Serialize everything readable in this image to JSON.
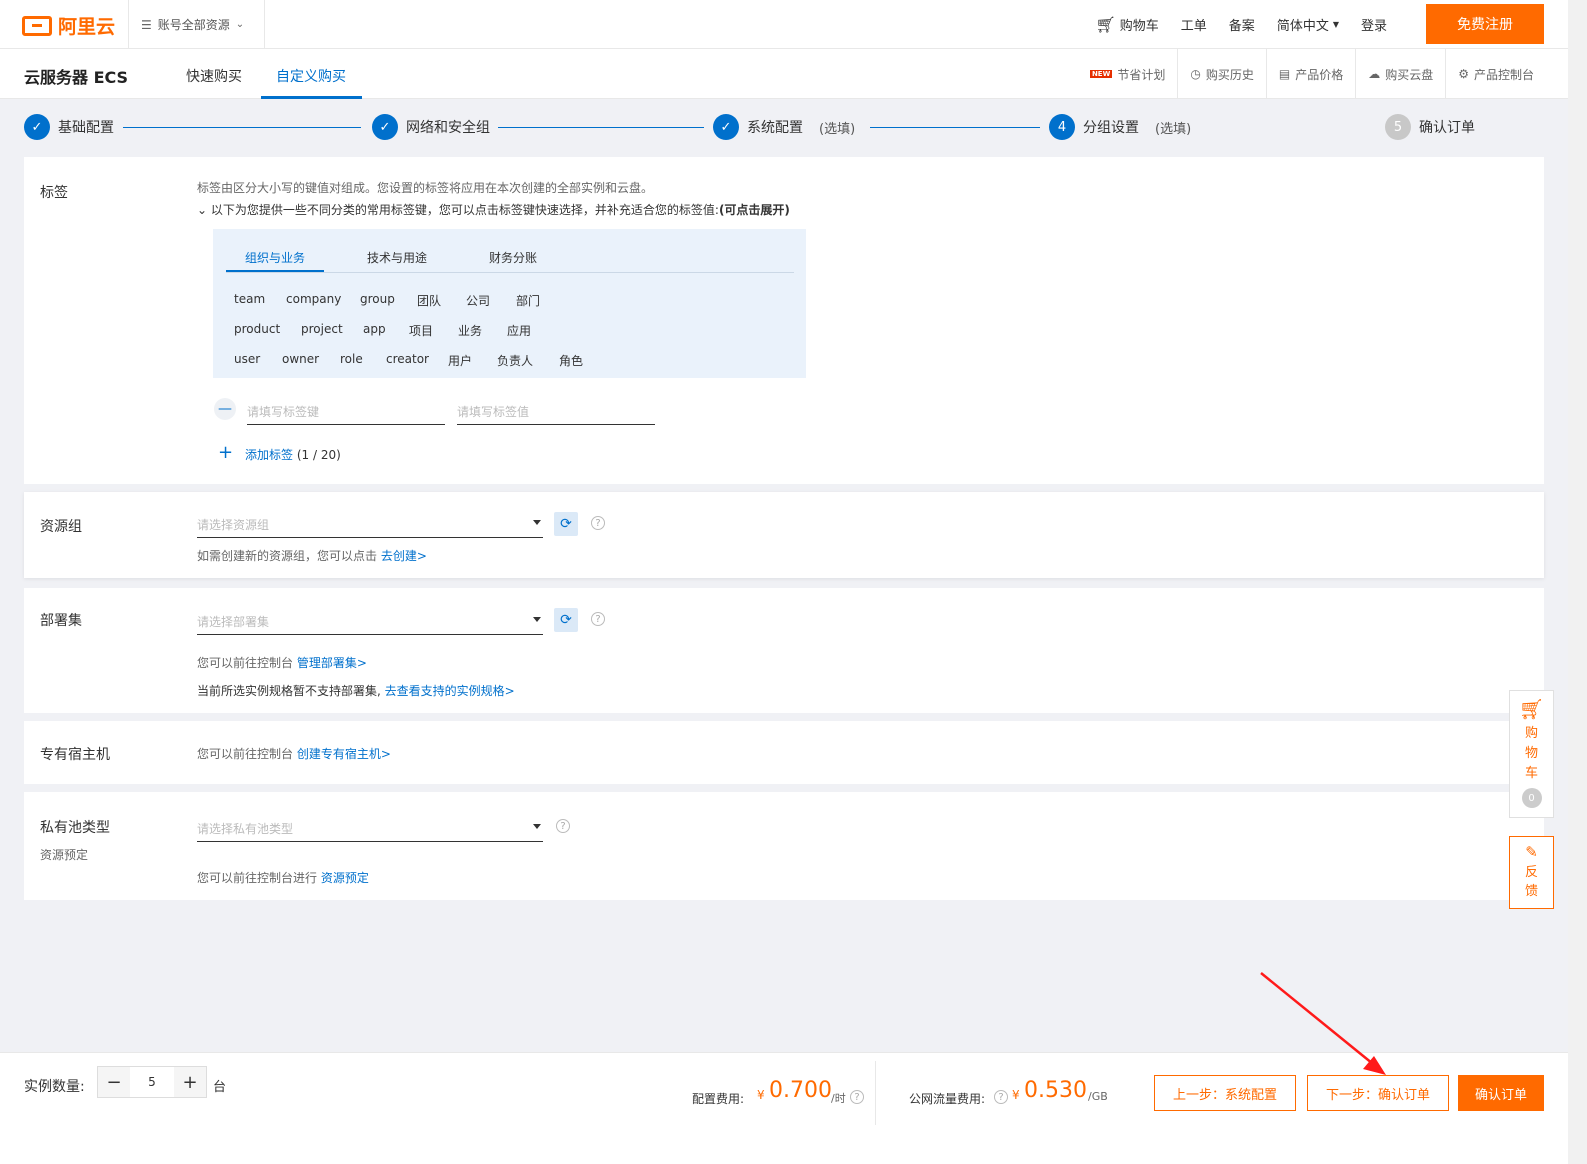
{
  "topbar": {
    "logo_text": "阿里云",
    "account_scope": "账号全部资源",
    "nav": [
      "购物车",
      "工单",
      "备案",
      "简体中文",
      "登录"
    ],
    "register": "免费注册"
  },
  "subbar": {
    "product": "云服务器 ECS",
    "tabs": [
      "快速购买",
      "自定义购买"
    ],
    "links": [
      "节省计划",
      "购买历史",
      "产品价格",
      "购买云盘",
      "产品控制台"
    ],
    "new_badge": "NEW"
  },
  "steps": [
    {
      "label": "基础配置",
      "state": "done"
    },
    {
      "label": "网络和安全组",
      "state": "done"
    },
    {
      "label": "系统配置",
      "optional": "(选填)",
      "state": "done"
    },
    {
      "label": "分组设置",
      "optional": "(选填)",
      "num": "4",
      "state": "active"
    },
    {
      "label": "确认订单",
      "num": "5",
      "state": "pending"
    }
  ],
  "tags": {
    "label": "标签",
    "help1": "标签由区分大小写的键值对组成。您设置的标签将应用在本次创建的全部实例和云盘。",
    "help2": "以下为您提供一些不同分类的常用标签键，您可以点击标签键快速选择，并补充适合您的标签值:",
    "help2_bold": "(可点击展开)",
    "tabs": [
      "组织与业务",
      "技术与用途",
      "财务分账"
    ],
    "rows": [
      [
        "team",
        "company",
        "group",
        "团队",
        "公司",
        "部门"
      ],
      [
        "product",
        "project",
        "app",
        "项目",
        "业务",
        "应用"
      ],
      [
        "user",
        "owner",
        "role",
        "creator",
        "用户",
        "负责人",
        "角色"
      ]
    ],
    "key_placeholder": "请填写标签键",
    "value_placeholder": "请填写标签值",
    "add_label": "添加标签",
    "add_count": "(1 / 20)"
  },
  "resource_group": {
    "label": "资源组",
    "placeholder": "请选择资源组",
    "help": "如需创建新的资源组，您可以点击",
    "link": "去创建>"
  },
  "deploy_set": {
    "label": "部署集",
    "placeholder": "请选择部署集",
    "help1": "您可以前往控制台",
    "link1": "管理部署集>",
    "help2": "当前所选实例规格暂不支持部署集,",
    "link2": "去查看支持的实例规格>"
  },
  "dedicated_host": {
    "label": "专有宿主机",
    "help": "您可以前往控制台",
    "link": "创建专有宿主机>"
  },
  "private_pool": {
    "label": "私有池类型",
    "sublabel": "资源预定",
    "placeholder": "请选择私有池类型",
    "help": "您可以前往控制台进行",
    "link": "资源预定"
  },
  "side": {
    "cart": [
      "购",
      "物",
      "车"
    ],
    "cart_count": "0",
    "feedback": [
      "反",
      "馈"
    ]
  },
  "footer": {
    "qty_label": "实例数量:",
    "qty": "5",
    "unit": "台",
    "config_fee_label": "配置费用:",
    "config_fee": "0.700",
    "config_fee_unit": "/时",
    "traffic_fee_label": "公网流量费用:",
    "traffic_fee": "0.530",
    "traffic_fee_unit": "/GB",
    "currency": "¥",
    "prev": "上一步：系统配置",
    "next": "下一步：确认订单",
    "confirm": "确认订单"
  },
  "colors": {
    "accent": "#ff6a00",
    "primary": "#0070cc"
  }
}
